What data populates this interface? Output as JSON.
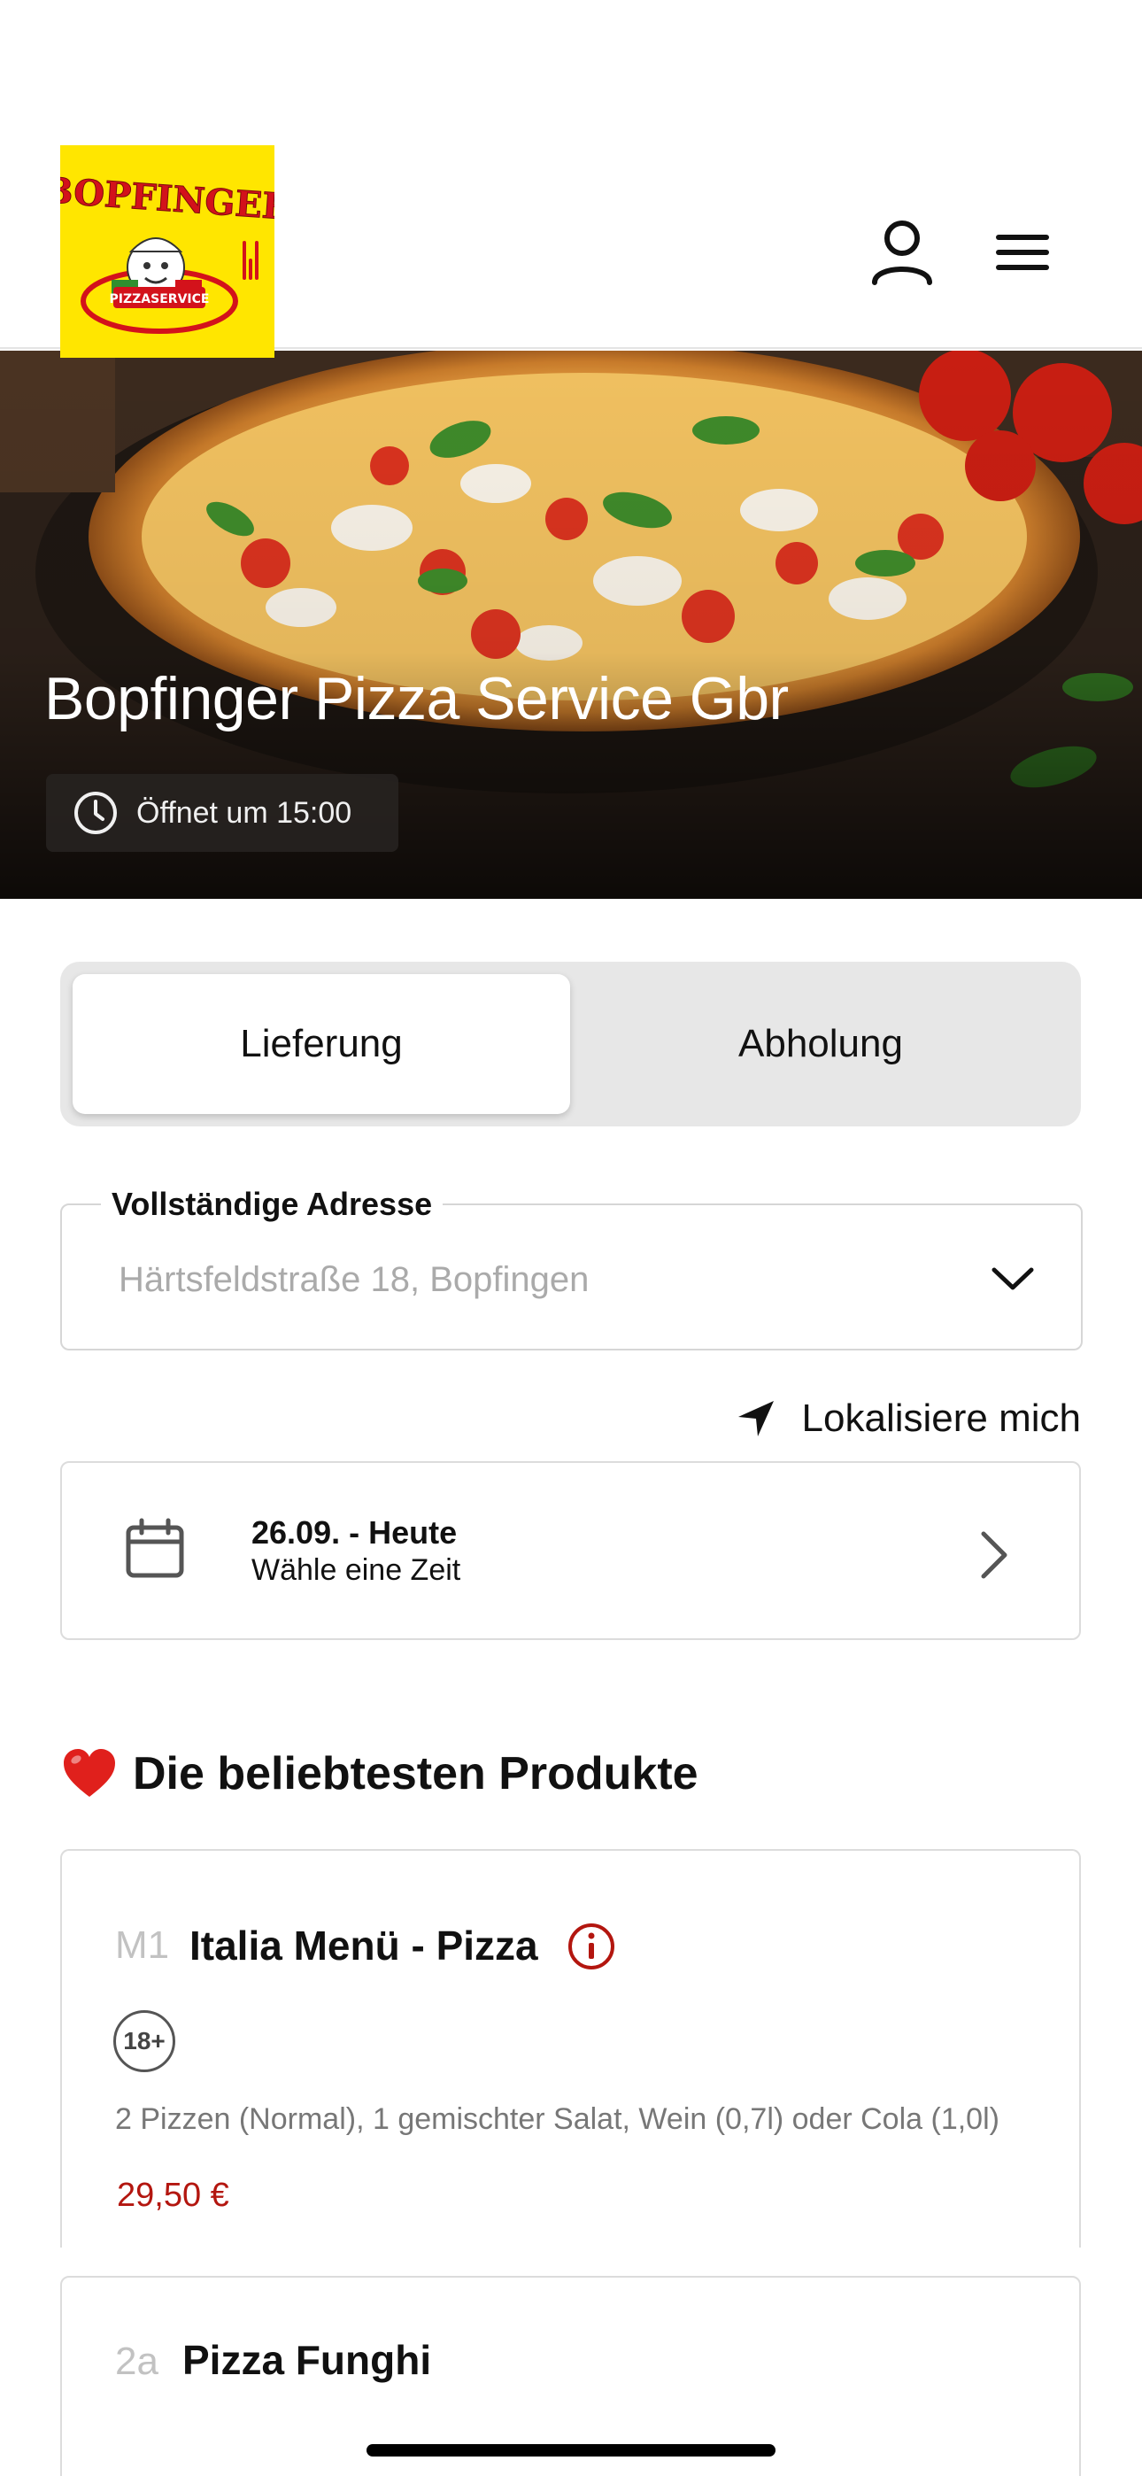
{
  "header": {
    "logo": {
      "name": "bopfinger-pizzaservice-logo",
      "text_top": "BOPFINGER",
      "text_bottom": "PIZZASERVICE"
    },
    "account_icon": "user-icon",
    "menu_icon": "hamburger-menu-icon"
  },
  "hero": {
    "title": "Bopfinger Pizza Service Gbr",
    "open_status": "Öffnet um 15:00",
    "clock_icon": "clock-icon"
  },
  "order_mode": {
    "options": [
      "Lieferung",
      "Abholung"
    ],
    "selected": "Lieferung"
  },
  "address": {
    "label": "Vollständige Adresse",
    "value": "Härtsfeldstraße 18, Bopfingen",
    "dropdown_icon": "chevron-down-icon"
  },
  "locate": {
    "label": "Lokalisiere mich",
    "icon": "location-arrow-icon"
  },
  "date_picker": {
    "date": "26.09. - Heute",
    "prompt": "Wähle eine Zeit",
    "icon": "calendar-icon"
  },
  "popular": {
    "title": "Die beliebtesten Produkte",
    "emoji": "❤️",
    "products": [
      {
        "code": "M1",
        "name": "Italia Menü - Pizza",
        "badge": "18+",
        "description": "2 Pizzen (Normal), 1 gemischter Salat, Wein (0,7l) oder Cola (1,0l)",
        "price": "29,50 €"
      },
      {
        "code": "2a",
        "name": "Pizza Funghi"
      }
    ]
  },
  "colors": {
    "accent_red": "#b3160f",
    "logo_yellow": "#ffe600",
    "toggle_bg": "#e7e7e7"
  }
}
